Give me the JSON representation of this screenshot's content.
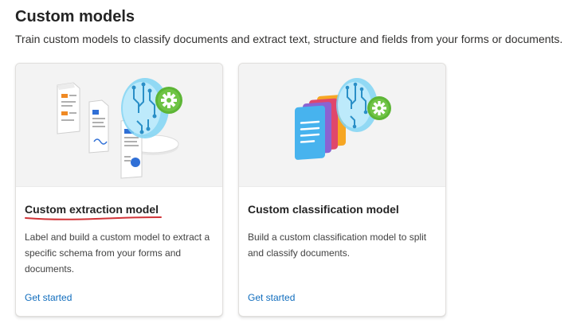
{
  "header": {
    "title": "Custom models",
    "subtitle": "Train custom models to classify documents and extract text, structure and fields from your forms or documents."
  },
  "cards": [
    {
      "title": "Custom extraction model",
      "description": "Label and build a custom model to extract a specific schema from your forms and documents.",
      "link": "Get started"
    },
    {
      "title": "Custom classification model",
      "description": "Build a custom classification model to split and classify documents.",
      "link": "Get started"
    }
  ],
  "colors": {
    "link": "#0f6cbd",
    "annotation_underline": "#d13438",
    "gear_green": "#5db536",
    "brain_blue": "#5fc0ea"
  },
  "icons": [
    "document-icon",
    "brain-circuit-icon",
    "gear-icon",
    "document-stack-icon"
  ]
}
